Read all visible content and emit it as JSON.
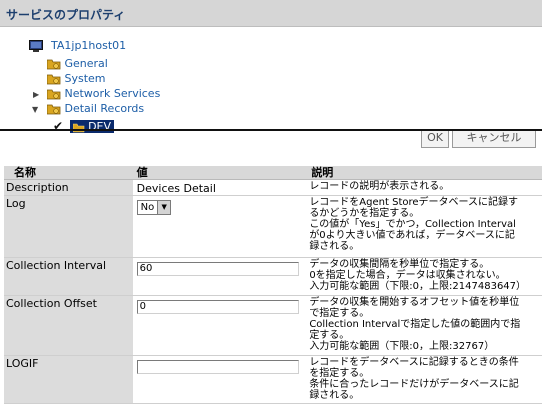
{
  "window": {
    "title": "サービスのプロパティ"
  },
  "tree": {
    "host": "TA1jp1host01",
    "items": [
      {
        "label": "General"
      },
      {
        "label": "System"
      },
      {
        "label": "Network Services"
      },
      {
        "label": "Detail Records"
      }
    ],
    "selected": "DEV"
  },
  "buttons": {
    "ok": "OK",
    "cancel": "キャンセル"
  },
  "table": {
    "headers": {
      "name": "名称",
      "value": "値",
      "description": "説明"
    },
    "rows": [
      {
        "name": "Description",
        "value": "Devices Detail",
        "desc": [
          "レコードの説明が表示される。"
        ]
      },
      {
        "name": "Log",
        "value": "No",
        "desc": [
          "レコードをAgent Storeデータベースに記録す",
          "るかどうかを指定する。",
          "この値が「Yes」でかつ，Collection Interval",
          "が0より大きい値であれば，データベースに記",
          "録される。"
        ]
      },
      {
        "name": "Collection Interval",
        "value": "60",
        "desc": [
          "データの収集間隔を秒単位で指定する。",
          "0を指定した場合，データは収集されない。",
          "入力可能な範囲（下限:0，上限:2147483647）"
        ]
      },
      {
        "name": "Collection Offset",
        "value": "0",
        "desc": [
          "データの収集を開始するオフセット値を秒単位",
          "で指定する。",
          "Collection Intervalで指定した値の範囲内で指",
          "定する。",
          "入力可能な範囲（下限:0，上限:32767）"
        ]
      },
      {
        "name": "LOGIF",
        "value": "",
        "desc": [
          "レコードをデータベースに記録するときの条件",
          "を指定する。",
          "条件に合ったレコードだけがデータベースに記",
          "録される。"
        ]
      }
    ]
  },
  "colors": {
    "link": "#1d5ea7",
    "selection": "#0a2a6c",
    "title_text": "#1d3f6e"
  }
}
